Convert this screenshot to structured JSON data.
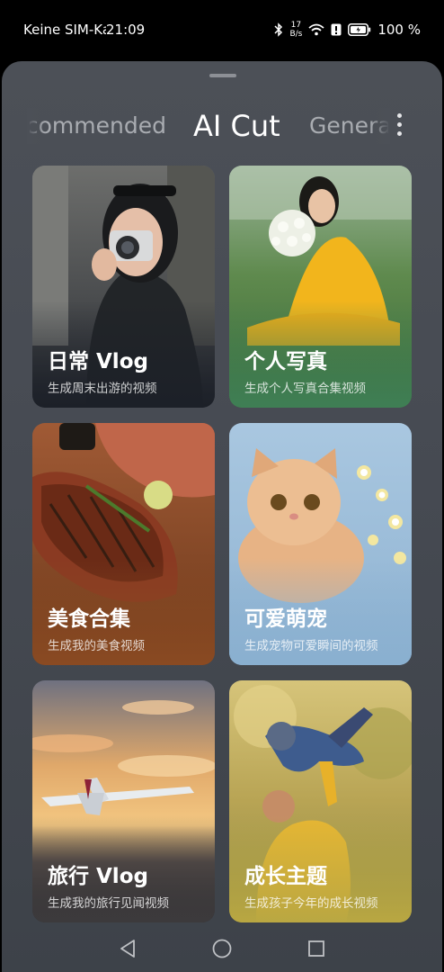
{
  "status_bar": {
    "carrier": "Keine SIM-Karte",
    "time": "21:09",
    "net_speed_value": "17",
    "net_speed_unit": "B/s",
    "battery_percent": "100 %"
  },
  "tabs": {
    "left": "Recommended",
    "active": "AI Cut",
    "right": "General"
  },
  "cards": [
    {
      "title": "日常 Vlog",
      "subtitle": "生成周末出游的视频",
      "accent": "#1c2028"
    },
    {
      "title": "个人写真",
      "subtitle": "生成个人写真合集视频",
      "accent": "#3f7f55"
    },
    {
      "title": "美食合集",
      "subtitle": "生成我的美食视频",
      "accent": "#8a4a22"
    },
    {
      "title": "可爱萌宠",
      "subtitle": "生成宠物可爱瞬间的视频",
      "accent": "#8ab0d0"
    },
    {
      "title": "旅行 Vlog",
      "subtitle": "生成我的旅行见闻视频",
      "accent": "#3c3a3c"
    },
    {
      "title": "成长主题",
      "subtitle": "生成孩子今年的成长视频",
      "accent": "#b9a742"
    }
  ],
  "icons": {
    "bluetooth": "bluetooth-icon",
    "wifi": "wifi-icon",
    "alert": "alert-icon",
    "battery": "battery-icon",
    "more": "more-vertical-icon",
    "back": "back-icon",
    "home": "home-icon",
    "recents": "recents-icon"
  }
}
